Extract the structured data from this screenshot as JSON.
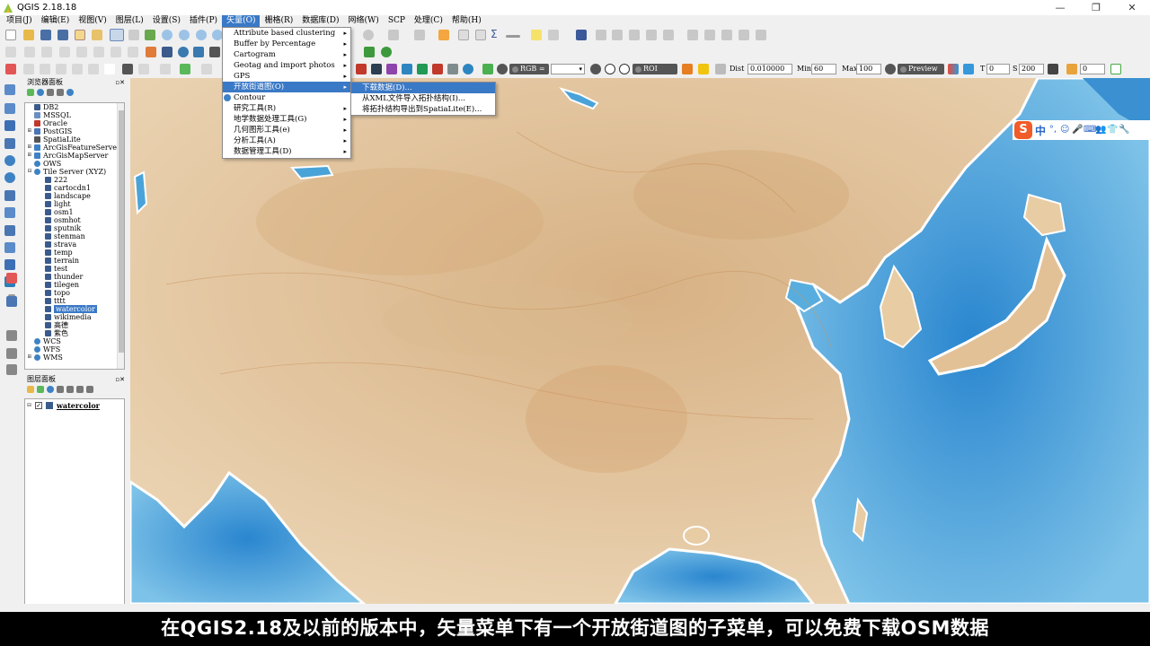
{
  "window": {
    "title": "QGIS 2.18.18",
    "controls": [
      "—",
      "❐",
      "✕"
    ]
  },
  "menubar": [
    {
      "label": "项目(J)"
    },
    {
      "label": "编辑(E)"
    },
    {
      "label": "视图(V)"
    },
    {
      "label": "图层(L)"
    },
    {
      "label": "设置(S)"
    },
    {
      "label": "插件(P)"
    },
    {
      "label": "矢量(O)",
      "active": true
    },
    {
      "label": "栅格(R)"
    },
    {
      "label": "数据库(D)"
    },
    {
      "label": "网络(W)"
    },
    {
      "label": "SCP"
    },
    {
      "label": "处理(C)"
    },
    {
      "label": "帮助(H)"
    }
  ],
  "vector_menu": [
    {
      "label": "Attribute based clustering",
      "submenu": true
    },
    {
      "label": "Buffer by Percentage",
      "submenu": true
    },
    {
      "label": "Cartogram",
      "submenu": true
    },
    {
      "label": "Geotag and import photos",
      "submenu": true
    },
    {
      "label": "GPS",
      "submenu": true
    },
    {
      "label": "开放街道图(O)",
      "submenu": true,
      "highlighted": true
    },
    {
      "label": "Contour",
      "submenu": false,
      "icon": "contour-icon"
    },
    {
      "label": "研究工具(R)",
      "submenu": true
    },
    {
      "label": "地学数据处理工具(G)",
      "submenu": true
    },
    {
      "label": "几何图形工具(e)",
      "submenu": true
    },
    {
      "label": "分析工具(A)",
      "submenu": true
    },
    {
      "label": "数据管理工具(D)",
      "submenu": true
    }
  ],
  "osm_submenu": [
    {
      "label": "下载数据(D)...",
      "highlighted": true
    },
    {
      "label": "从XML文件导入拓扑结构(I)..."
    },
    {
      "label": "将拓扑结构导出到SpatiaLite(E)..."
    }
  ],
  "toolbar": {
    "rgb_label": "RGB =",
    "roi_label": "ROI",
    "dist_label": "Dist",
    "dist_value": "0.010000",
    "min_label": "Min",
    "min_value": "60",
    "max_label": "Max",
    "max_value": "100",
    "preview_label": "Preview",
    "t_label": "T",
    "t_value": "0",
    "s_label": "S",
    "s_value": "200",
    "last_value": "0"
  },
  "browser_panel": {
    "title": "浏览器面板",
    "items": [
      {
        "label": "DB2",
        "indent": 0,
        "expander": false
      },
      {
        "label": "MSSQL",
        "indent": 0,
        "expander": false
      },
      {
        "label": "Oracle",
        "indent": 0,
        "expander": false
      },
      {
        "label": "PostGIS",
        "indent": 0,
        "expander": true
      },
      {
        "label": "SpatiaLite",
        "indent": 0,
        "expander": false
      },
      {
        "label": "ArcGisFeatureServe",
        "indent": 0,
        "expander": true
      },
      {
        "label": "ArcGisMapServer",
        "indent": 0,
        "expander": true
      },
      {
        "label": "OWS",
        "indent": 0,
        "expander": false
      },
      {
        "label": "Tile Server (XYZ)",
        "indent": 0,
        "expander": true,
        "expanded": true
      },
      {
        "label": "222",
        "indent": 1
      },
      {
        "label": "cartocdn1",
        "indent": 1
      },
      {
        "label": "landscape",
        "indent": 1
      },
      {
        "label": "light",
        "indent": 1
      },
      {
        "label": "osm1",
        "indent": 1
      },
      {
        "label": "osmhot",
        "indent": 1
      },
      {
        "label": "sputnik",
        "indent": 1
      },
      {
        "label": "stenman",
        "indent": 1
      },
      {
        "label": "strava",
        "indent": 1
      },
      {
        "label": "temp",
        "indent": 1
      },
      {
        "label": "terrain",
        "indent": 1
      },
      {
        "label": "test",
        "indent": 1
      },
      {
        "label": "thunder",
        "indent": 1
      },
      {
        "label": "tilegen",
        "indent": 1
      },
      {
        "label": "topo",
        "indent": 1
      },
      {
        "label": "tttt",
        "indent": 1
      },
      {
        "label": "watercolor",
        "indent": 1,
        "selected": true
      },
      {
        "label": "wikimedia",
        "indent": 1
      },
      {
        "label": "高德",
        "indent": 1
      },
      {
        "label": "紫色",
        "indent": 1
      },
      {
        "label": "WCS",
        "indent": 0,
        "expander": false
      },
      {
        "label": "WFS",
        "indent": 0,
        "expander": false
      },
      {
        "label": "WMS",
        "indent": 0,
        "expander": true
      }
    ]
  },
  "layers_panel": {
    "title": "图层面板",
    "layers": [
      {
        "label": "watercolor",
        "checked": true
      }
    ]
  },
  "ime": {
    "logo": "S",
    "mode": "中",
    "icons": [
      "°,",
      "☺",
      "🎤",
      "⌨",
      "👥",
      "👕",
      "🔧"
    ]
  },
  "subtitle": "在QGIS2.18及以前的版本中，矢量菜单下有一个开放街道图的子菜单，可以免费下载OSM数据",
  "colors": {
    "accent": "#3a79c6",
    "map_land": "#e6cba6",
    "map_water": "#4aa3d8"
  }
}
